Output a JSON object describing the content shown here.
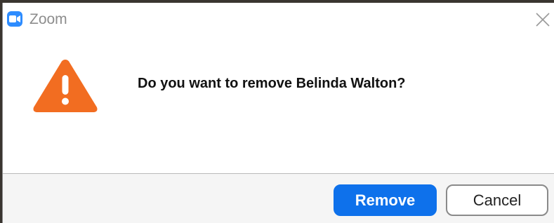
{
  "window": {
    "title": "Zoom",
    "icon": "zoom-video-icon",
    "close_icon": "close-icon"
  },
  "dialog": {
    "icon": "warning-icon",
    "message": "Do you want to remove Belinda Walton?"
  },
  "buttons": {
    "remove_label": "Remove",
    "cancel_label": "Cancel"
  },
  "colors": {
    "accent": "#0e71eb",
    "warning": "#f26d21",
    "app_icon": "#2d8cff"
  }
}
